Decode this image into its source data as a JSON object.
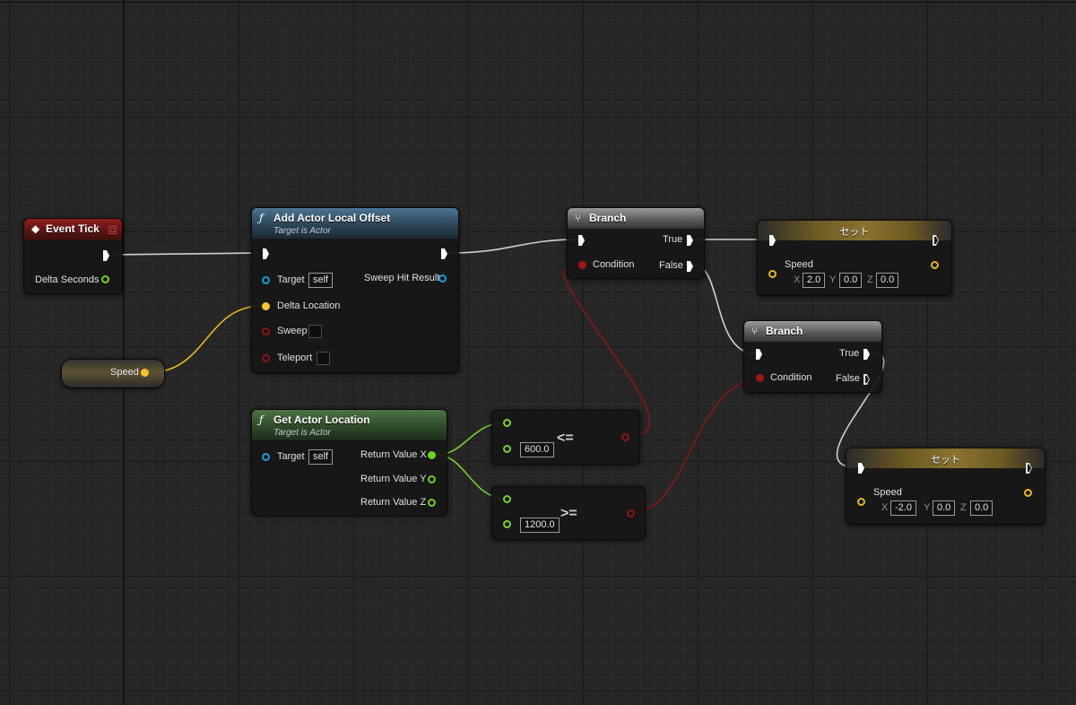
{
  "colors": {
    "exec": "#ffffff",
    "float": "#a6e234",
    "vector": "#f7c12a",
    "object": "#1b9bdc",
    "bool": "#8e1414",
    "wire_exec": "#d0d0d0"
  },
  "nodes": {
    "event_tick": {
      "title": "Event Tick",
      "icon": "event-diamond-icon",
      "out_delta": "Delta Seconds"
    },
    "speed_getter": {
      "label": "Speed"
    },
    "add_offset": {
      "title": "Add Actor Local Offset",
      "subtitle": "Target is Actor",
      "target_label": "Target",
      "target_value": "self",
      "delta_label": "Delta Location",
      "sweep_label": "Sweep",
      "teleport_label": "Teleport",
      "sweep_hit_label": "Sweep Hit Result"
    },
    "get_location": {
      "title": "Get Actor Location",
      "subtitle": "Target is Actor",
      "target_label": "Target",
      "target_value": "self",
      "out_x": "Return Value X",
      "out_y": "Return Value Y",
      "out_z": "Return Value Z"
    },
    "compare_le": {
      "operator": "<=",
      "value": "600.0"
    },
    "compare_ge": {
      "operator": ">=",
      "value": "1200.0"
    },
    "branch_1": {
      "title": "Branch",
      "condition": "Condition",
      "true_label": "True",
      "false_label": "False"
    },
    "branch_2": {
      "title": "Branch",
      "condition": "Condition",
      "true_label": "True",
      "false_label": "False"
    },
    "set_1": {
      "title": "セット",
      "var": "Speed",
      "x_label": "X",
      "x": "2.0",
      "y_label": "Y",
      "y": "0.0",
      "z_label": "Z",
      "z": "0.0"
    },
    "set_2": {
      "title": "セット",
      "var": "Speed",
      "x_label": "X",
      "x": "-2.0",
      "y_label": "Y",
      "y": "0.0",
      "z_label": "Z",
      "z": "0.0"
    }
  }
}
